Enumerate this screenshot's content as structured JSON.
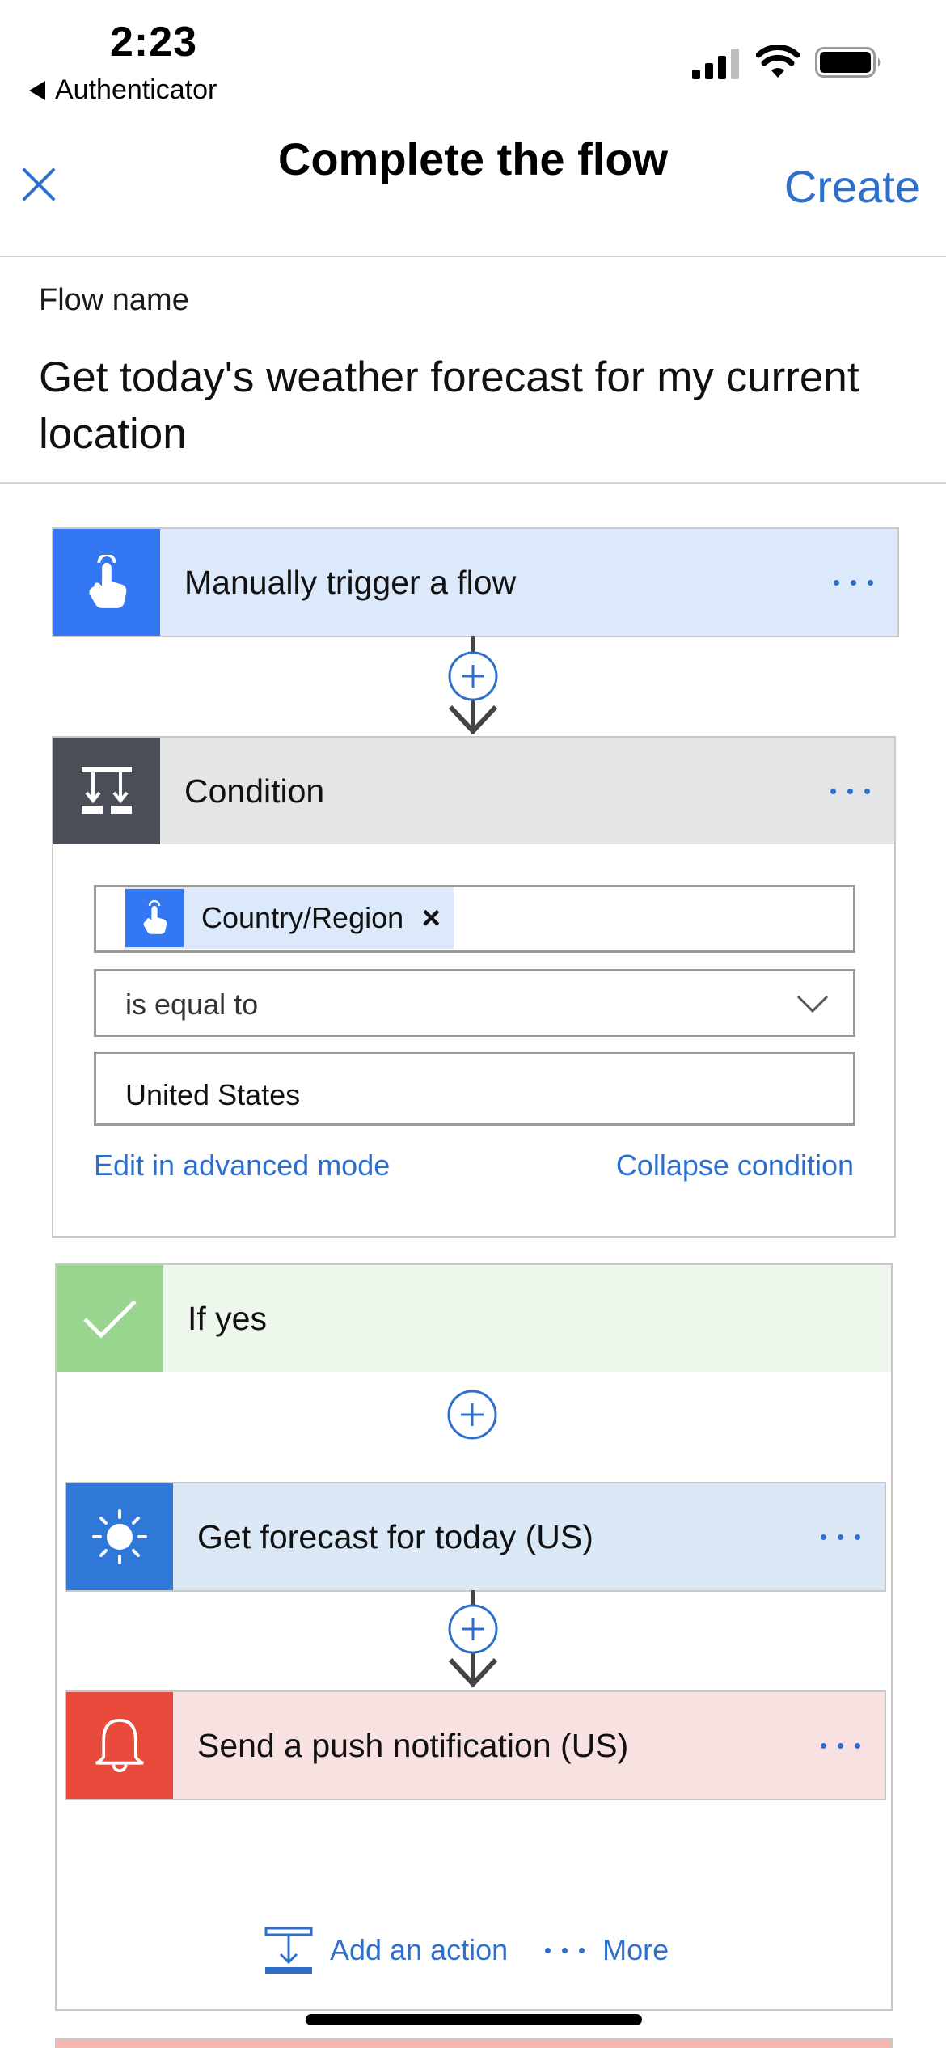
{
  "status_bar": {
    "time": "2:23",
    "back_app": "Authenticator",
    "icons": [
      "cellular-signal-icon",
      "wifi-icon",
      "battery-icon"
    ]
  },
  "nav": {
    "title": "Complete the flow",
    "close_icon": "close-icon",
    "create_label": "Create"
  },
  "flow_name": {
    "label": "Flow name",
    "value": "Get today's weather forecast for my current location"
  },
  "trigger": {
    "title": "Manually trigger a flow",
    "icon": "hand-touch-icon"
  },
  "condition": {
    "title": "Condition",
    "icon": "condition-branch-icon",
    "token_label": "Country/Region",
    "operator": "is equal to",
    "value": "United States",
    "edit_advanced_label": "Edit in advanced mode",
    "collapse_label": "Collapse condition"
  },
  "if_yes": {
    "title": "If yes",
    "icon": "checkmark-icon",
    "steps": [
      {
        "title": "Get forecast for today (US)",
        "icon": "sun-icon"
      },
      {
        "title": "Send a push notification (US)",
        "icon": "bell-icon"
      }
    ],
    "add_action_label": "Add an action",
    "more_label": "More"
  },
  "colors": {
    "accent": "#2f6fcc",
    "trigger_icon_bg": "#3377f2",
    "trigger_header_bg": "#dce9fb",
    "condition_icon_bg": "#4a4f57",
    "condition_header_bg": "#e4e5e7",
    "yes_icon_bg": "#9ad58f",
    "yes_header_bg": "#edf7ec",
    "forecast_icon_bg": "#2f78d8",
    "push_icon_bg": "#e84b3c",
    "push_header_bg": "#f8e1e1"
  }
}
